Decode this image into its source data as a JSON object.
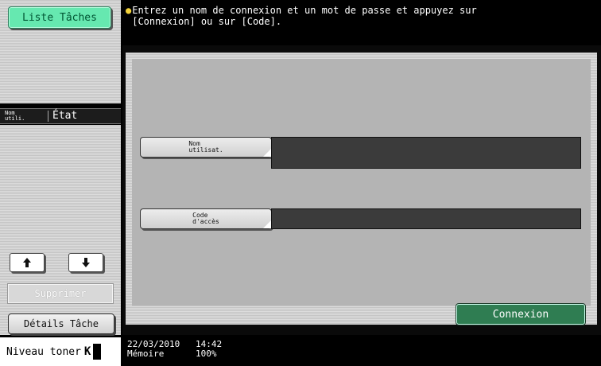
{
  "sidebar": {
    "job_list_label": "Liste Tâches",
    "table_header": {
      "name_col": "Nom\nutili.",
      "state_col": "État"
    },
    "delete_label": "Supprimer",
    "details_label": "Détails Tâche"
  },
  "toner": {
    "label": "Niveau toner",
    "color": "K"
  },
  "message": {
    "line1": "Entrez un nom de connexion et un mot de passe et appuyez sur",
    "line2": "[Connexion] ou sur [Code]."
  },
  "form": {
    "username_label": "Nom\nutilisat.",
    "username_value": "",
    "password_label": "Code\nd'accès",
    "password_value": ""
  },
  "login_button_label": "Connexion",
  "status_bar": {
    "date": "22/03/2010",
    "time": "14:42",
    "memory_label": "Mémoire",
    "memory_value": "100%"
  },
  "colors": {
    "accent_green": "#66e8b0",
    "login_green": "#2f7d52",
    "field_dark": "#3b3b3b",
    "tip_bulb": "#f3d23a"
  }
}
